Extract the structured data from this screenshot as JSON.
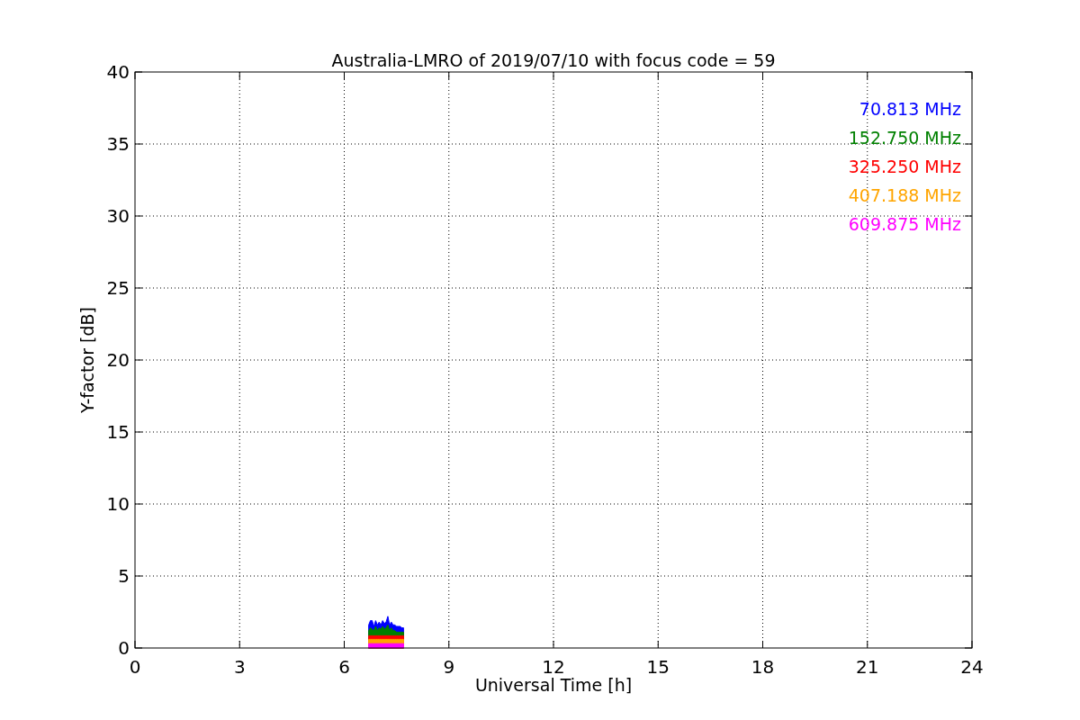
{
  "figure": {
    "chart_data": {
      "type": "area",
      "title": "Australia-LMRO of 2019/07/10 with focus code = 59",
      "xlabel": "Universal Time [h]",
      "ylabel": "Y-factor [dB]",
      "xlim": [
        0,
        24
      ],
      "ylim": [
        0,
        40
      ],
      "xticks": [
        0,
        3,
        6,
        9,
        12,
        15,
        18,
        21,
        24
      ],
      "yticks": [
        0,
        5,
        10,
        15,
        20,
        25,
        30,
        35,
        40
      ],
      "grid": true,
      "x": [
        6.7,
        6.75,
        6.8,
        6.85,
        6.9,
        6.95,
        7.0,
        7.05,
        7.1,
        7.15,
        7.2,
        7.25,
        7.3,
        7.35,
        7.4,
        7.45,
        7.5,
        7.55,
        7.6,
        7.65,
        7.7
      ],
      "series": [
        {
          "name": "70.813 MHz",
          "color": "#0000ff",
          "values": [
            1.6,
            1.9,
            1.9,
            1.5,
            1.9,
            1.6,
            1.8,
            1.6,
            1.9,
            1.7,
            1.8,
            2.2,
            1.6,
            1.8,
            1.6,
            1.6,
            1.5,
            1.5,
            1.5,
            1.4,
            1.4
          ]
        },
        {
          "name": "152.750 MHz",
          "color": "#008000",
          "values": [
            1.2,
            1.4,
            1.3,
            1.2,
            1.5,
            1.2,
            1.4,
            1.3,
            1.5,
            1.3,
            1.4,
            1.6,
            1.2,
            1.4,
            1.2,
            1.2,
            1.1,
            1.1,
            1.1,
            1.1,
            1.1
          ]
        },
        {
          "name": "325.250 MHz",
          "color": "#ff0000",
          "values": [
            0.85,
            0.85,
            0.85,
            0.85,
            0.85,
            0.85,
            0.85,
            0.85,
            0.85,
            0.85,
            0.85,
            0.85,
            0.85,
            0.85,
            0.85,
            0.85,
            0.85,
            0.85,
            0.85,
            0.85,
            0.85
          ]
        },
        {
          "name": "407.188 MHz",
          "color": "#ffa500",
          "values": [
            0.6,
            0.6,
            0.6,
            0.6,
            0.6,
            0.6,
            0.6,
            0.6,
            0.6,
            0.6,
            0.6,
            0.6,
            0.6,
            0.6,
            0.6,
            0.6,
            0.6,
            0.6,
            0.6,
            0.6,
            0.6
          ]
        },
        {
          "name": "609.875 MHz",
          "color": "#ff00ff",
          "values": [
            0.3,
            0.3,
            0.3,
            0.3,
            0.3,
            0.3,
            0.3,
            0.3,
            0.3,
            0.3,
            0.3,
            0.3,
            0.3,
            0.3,
            0.3,
            0.3,
            0.3,
            0.3,
            0.3,
            0.3,
            0.3
          ]
        }
      ]
    }
  }
}
